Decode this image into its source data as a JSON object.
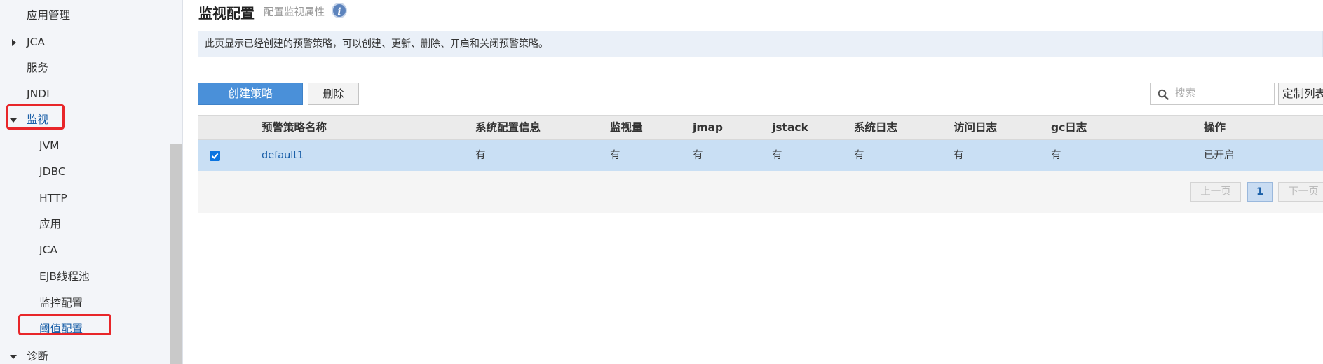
{
  "sidebar": {
    "items": [
      {
        "label": "应用管理"
      },
      {
        "label": "JCA"
      },
      {
        "label": "服务"
      },
      {
        "label": "JNDI"
      },
      {
        "label": "监视"
      },
      {
        "label": "JVM"
      },
      {
        "label": "JDBC"
      },
      {
        "label": "HTTP"
      },
      {
        "label": "应用"
      },
      {
        "label": "JCA"
      },
      {
        "label": "EJB线程池"
      },
      {
        "label": "监控配置"
      },
      {
        "label": "阈值配置"
      },
      {
        "label": "诊断"
      }
    ]
  },
  "header": {
    "title": "监视配置",
    "subtitle": "配置监视属性",
    "info_icon": "i"
  },
  "description": "此页显示已经创建的预警策略，可以创建、更新、删除、开启和关闭预警策略。",
  "toolbar": {
    "create_label": "创建策略",
    "delete_label": "删除",
    "search_placeholder": "搜索",
    "custom_columns_label": "定制列表"
  },
  "table": {
    "columns": [
      "预警策略名称",
      "系统配置信息",
      "监视量",
      "jmap",
      "jstack",
      "系统日志",
      "访问日志",
      "gc日志",
      "操作"
    ],
    "rows": [
      {
        "name": "default1",
        "sysconfig": "有",
        "monitor": "有",
        "jmap": "有",
        "jstack": "有",
        "syslog": "有",
        "accesslog": "有",
        "gclog": "有",
        "op": "已开启",
        "checked": true
      }
    ]
  },
  "pagination": {
    "prev": "上一页",
    "current": "1",
    "next": "下一页"
  },
  "colors": {
    "accent": "#4a90d9",
    "selected_row": "#c9dff4",
    "annotation": "#e8262a"
  }
}
